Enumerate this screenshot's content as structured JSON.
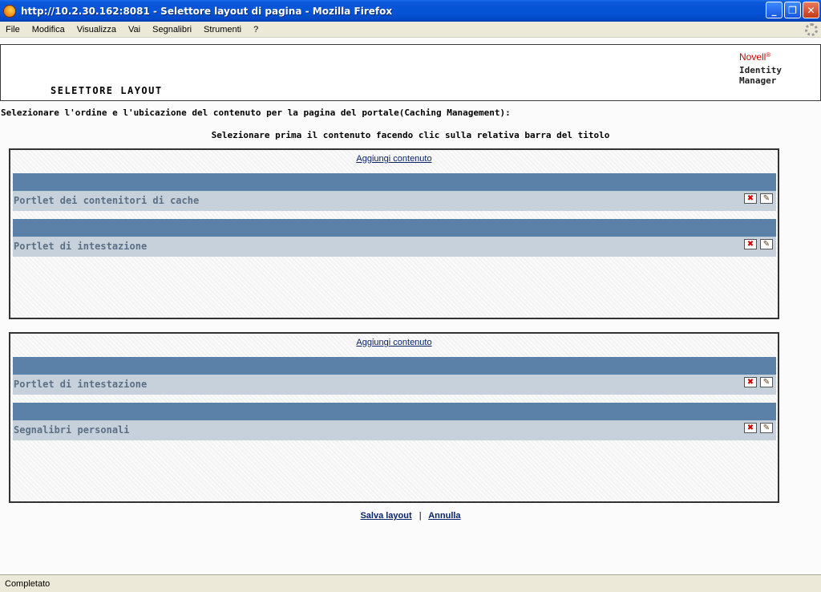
{
  "window": {
    "title": "http://10.2.30.162:8081 - Selettore layout di pagina - Mozilla Firefox",
    "minimize_label": "_",
    "maximize_label": "❐",
    "close_label": "✕"
  },
  "menu": [
    "File",
    "Modifica",
    "Visualizza",
    "Vai",
    "Segnalibri",
    "Strumenti",
    "?"
  ],
  "header": {
    "page_title": "SELETTORE LAYOUT",
    "brand": "Novell",
    "brand_mark": "®",
    "product": "Identity Manager"
  },
  "instructions": {
    "line1": "Selezionare l'ordine e l'ubicazione del contenuto per la pagina del portale(Caching Management):",
    "line2": "Selezionare prima il contenuto facendo clic sulla relativa barra del titolo"
  },
  "regions": [
    {
      "add_content": "Aggiungi contenuto",
      "portlets": [
        {
          "title": "Portlet dei contenitori di cache"
        },
        {
          "title": "Portlet di intestazione"
        }
      ]
    },
    {
      "add_content": "Aggiungi contenuto",
      "portlets": [
        {
          "title": "Portlet di intestazione"
        },
        {
          "title": "Segnalibri personali"
        }
      ]
    }
  ],
  "icons": {
    "delete": "✖",
    "edit": "✎"
  },
  "actions": {
    "save": "Salva layout",
    "separator": "|",
    "cancel": "Annulla"
  },
  "status": "Completato"
}
